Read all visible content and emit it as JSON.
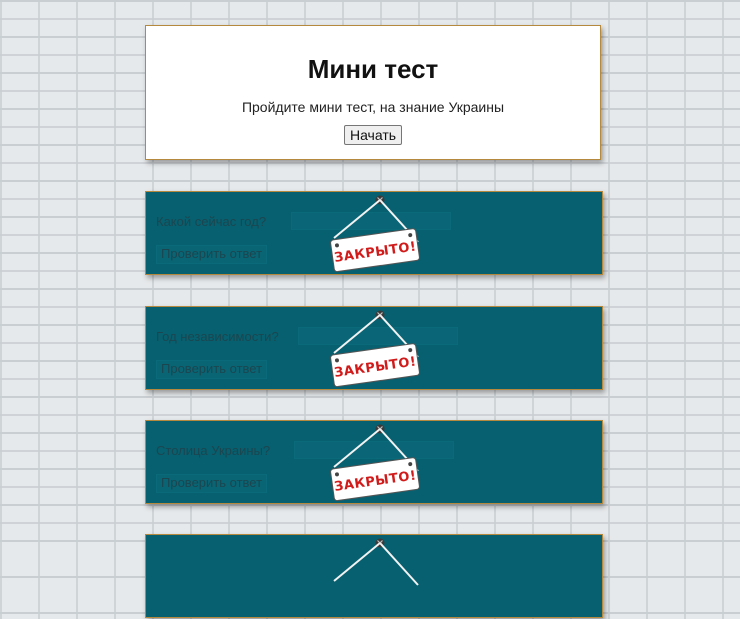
{
  "intro": {
    "title": "Мини тест",
    "subtitle": "Пройдите мини тест, на знание Украины",
    "start_label": "Начать"
  },
  "questions": [
    {
      "label": "Какой сейчас год?",
      "check_label": "Проверить ответ"
    },
    {
      "label": "Год независимости?",
      "check_label": "Проверить ответ"
    },
    {
      "label": "Столица Украины?",
      "check_label": "Проверить ответ"
    },
    {
      "label": "",
      "check_label": ""
    }
  ],
  "closed_sign": {
    "text": "ЗАКРЫТО!"
  },
  "colors": {
    "card_bg": "#07606f",
    "card_border": "#b5893e",
    "sign_text": "#d11b1b"
  }
}
